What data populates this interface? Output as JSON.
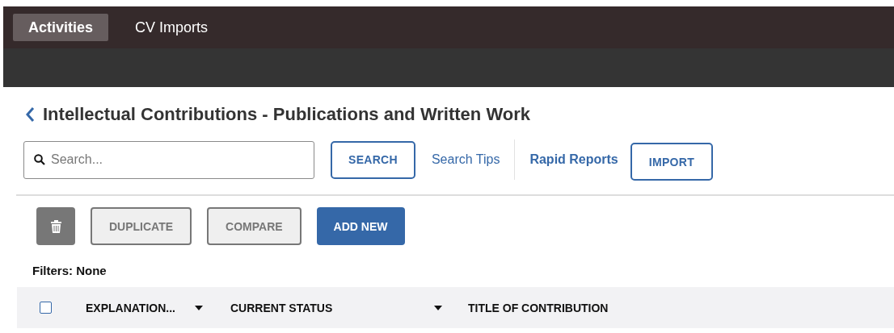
{
  "nav": {
    "tabs": [
      {
        "label": "Activities",
        "selected": true
      },
      {
        "label": "CV Imports",
        "selected": false
      }
    ]
  },
  "page": {
    "title": "Intellectual Contributions - Publications and Written Work"
  },
  "search": {
    "placeholder": "Search...",
    "button": "SEARCH",
    "tips_link": "Search Tips"
  },
  "rapid_reports_link": "Rapid Reports",
  "import_button": "IMPORT",
  "toolbar": [
    {
      "kind": "icon",
      "disabled": true
    },
    {
      "kind": "text",
      "label": "DUPLICATE",
      "disabled": true
    },
    {
      "kind": "text",
      "label": "COMPARE",
      "disabled": true
    },
    {
      "kind": "text",
      "label": "ADD NEW",
      "disabled": false
    }
  ],
  "filters": "Filters: None",
  "table": {
    "select_all_checked": false,
    "columns": [
      {
        "label": "EXPLANATION...",
        "sortable": true
      },
      {
        "label": "CURRENT STATUS",
        "sortable": true
      },
      {
        "label": "TITLE OF CONTRIBUTION",
        "sortable": false
      }
    ]
  }
}
